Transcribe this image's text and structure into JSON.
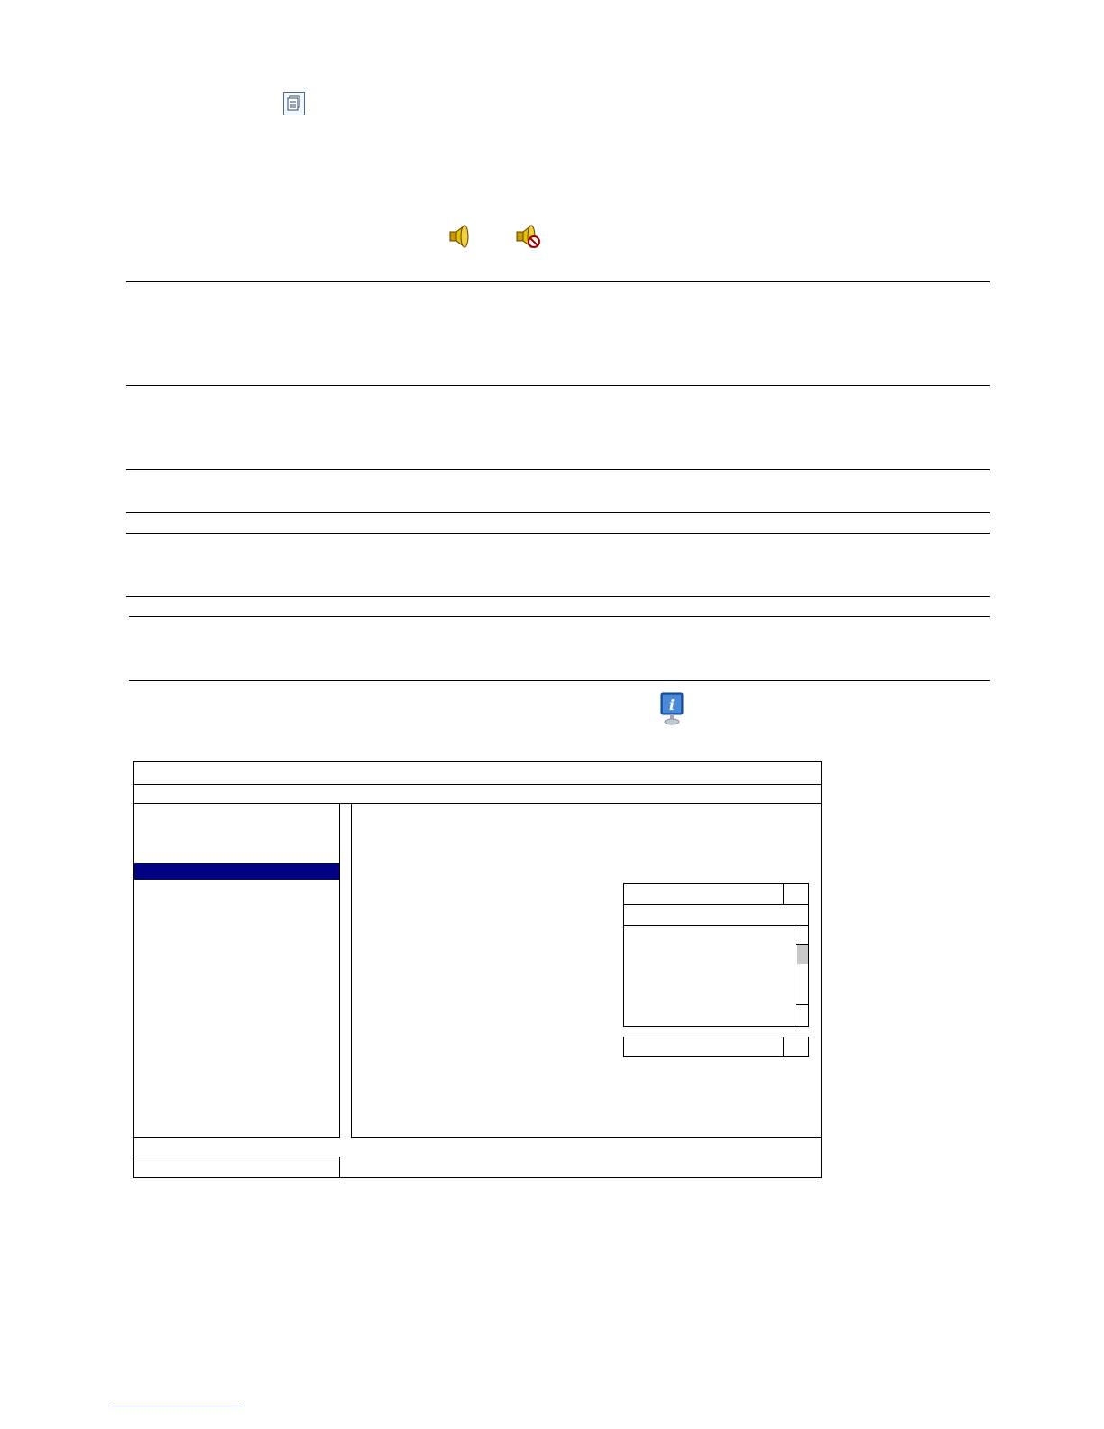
{
  "icons": {
    "document": "document-list-icon",
    "speaker_on": "speaker-icon",
    "speaker_muted": "speaker-muted-icon",
    "info": "info-monitor-icon"
  },
  "colors": {
    "selection": "#000080",
    "speaker": "#d4a800",
    "mute_badge": "#a00000",
    "info_blue": "#1e5fb0",
    "footer_link": "#3a5bd0"
  }
}
